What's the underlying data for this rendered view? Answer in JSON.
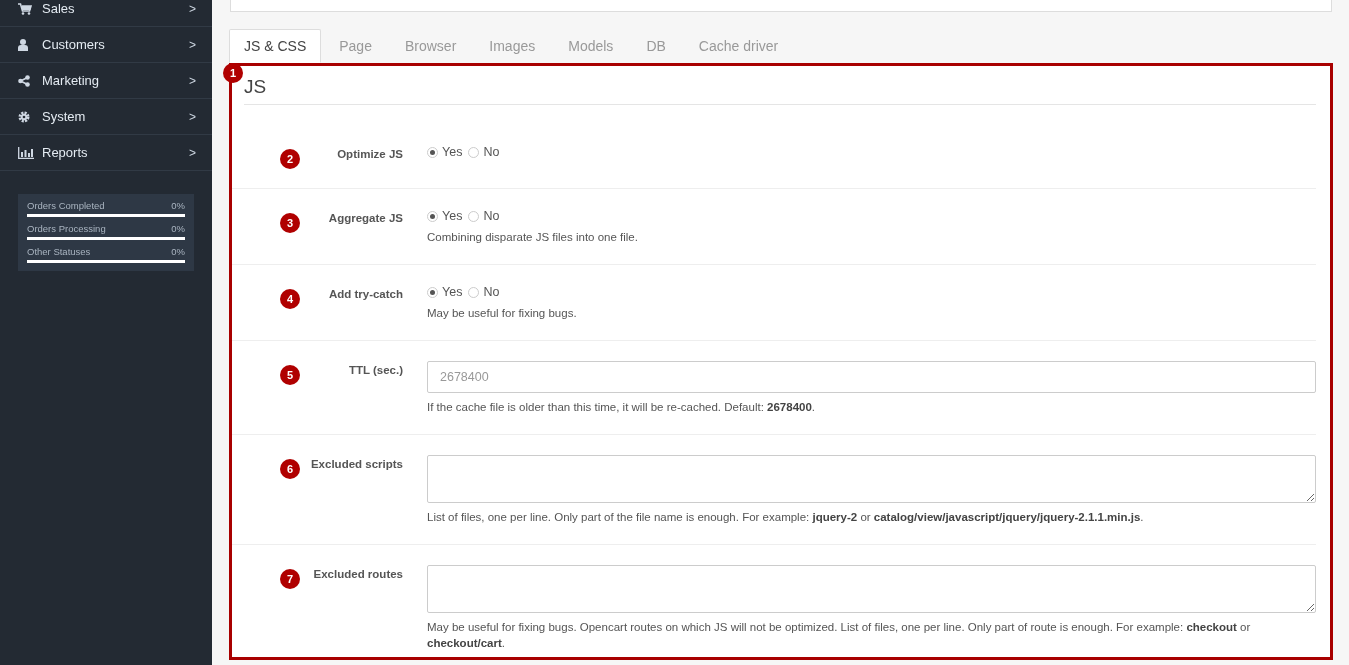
{
  "sidebar": {
    "items": [
      {
        "label": "Sales",
        "arrow": ">"
      },
      {
        "label": "Customers",
        "arrow": ">"
      },
      {
        "label": "Marketing",
        "arrow": ">"
      },
      {
        "label": "System",
        "arrow": ">"
      },
      {
        "label": "Reports",
        "arrow": ">"
      }
    ],
    "stats": [
      {
        "label": "Orders Completed",
        "value": "0%",
        "level": 0
      },
      {
        "label": "Orders Processing",
        "value": "0%",
        "level": 0
      },
      {
        "label": "Other Statuses",
        "value": "0%",
        "level": 0
      }
    ]
  },
  "tabs": [
    {
      "label": "JS & CSS",
      "selected": true
    },
    {
      "label": "Page",
      "selected": false
    },
    {
      "label": "Browser",
      "selected": false
    },
    {
      "label": "Images",
      "selected": false
    },
    {
      "label": "Models",
      "selected": false
    },
    {
      "label": "DB",
      "selected": false
    },
    {
      "label": "Cache driver",
      "selected": false
    }
  ],
  "section": {
    "badge": "1",
    "title": "JS",
    "rows": [
      {
        "kind": "radio",
        "badge": "2",
        "label": "Optimize JS",
        "options": [
          {
            "label": "Yes",
            "selected": true
          },
          {
            "label": "No",
            "selected": false
          }
        ]
      },
      {
        "kind": "radio",
        "badge": "3",
        "label": "Aggregate JS",
        "options": [
          {
            "label": "Yes",
            "selected": true
          },
          {
            "label": "No",
            "selected": false
          }
        ],
        "help": "Combining disparate JS files into one file."
      },
      {
        "kind": "radio",
        "badge": "4",
        "label": "Add try-catch",
        "options": [
          {
            "label": "Yes",
            "selected": true
          },
          {
            "label": "No",
            "selected": false
          }
        ],
        "help": "May be useful for fixing bugs."
      },
      {
        "kind": "input",
        "badge": "5",
        "label": "TTL (sec.)",
        "placeholder": "2678400",
        "help": "If the cache file is older than this time, it will be re-cached. Default: **2678400**."
      },
      {
        "kind": "textarea",
        "badge": "6",
        "label": "Excluded scripts",
        "help": "List of files, one per line. Only part of the file name is enough. For example: **jquery-2** or **catalog/view/javascript/jquery/jquery-2.1.1.min.js**."
      },
      {
        "kind": "textarea",
        "badge": "7",
        "label": "Excluded routes",
        "help": "May be useful for fixing bugs. Opencart routes on which JS will not be optimized. List of files, one per line. Only part of route is enough. For example: **checkout** or **checkout/cart**."
      }
    ]
  }
}
